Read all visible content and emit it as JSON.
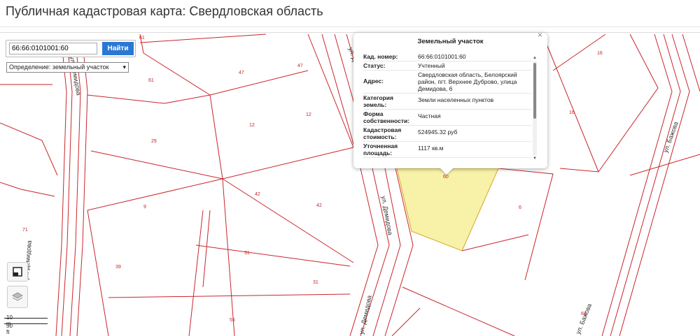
{
  "page": {
    "title": "Публичная кадастровая карта: Свердловская область"
  },
  "search": {
    "value": "66:66:0101001:60",
    "button_label": "Найти"
  },
  "definition_select": {
    "label": "Определение:",
    "selected": "земельный участок"
  },
  "scale": {
    "metric": "10 m",
    "imperial": "50 ft"
  },
  "parcel_labels": {
    "p61a": "61",
    "p61b": "61",
    "p47a": "47",
    "p47b": "47",
    "p12a": "12",
    "p12b": "12",
    "p29": "29",
    "p9": "9",
    "p42a": "42",
    "p42b": "42",
    "p31a": "31",
    "p31b": "31",
    "p39": "39",
    "p55": "55",
    "p71": "71",
    "p6": "6",
    "p16a": "16",
    "p16b": "16",
    "p68": "68",
    "p60": "60"
  },
  "streets": {
    "demidova_top": "ул. Демидова",
    "demidova_mid": "ул. Демидова",
    "demidova_bottom": "ул. Демидова",
    "bazhova_top": "ул. Бажова",
    "bazhova_bottom": "ул. Бажова",
    "left_street_top": "ул. Демидова",
    "left_street_bottom": "ул. Демидова"
  },
  "popup": {
    "title": "Земельный участок",
    "close": "×",
    "rows": [
      {
        "key": "Кад. номер:",
        "value": "66:66:0101001:60"
      },
      {
        "key": "Статус:",
        "value": "Учтенный"
      },
      {
        "key": "Адрес:",
        "value": "Свердловская область, Белоярский район, пгт. Верхнее Дуброво, улица Демидова, 6"
      },
      {
        "key": "Категория земель:",
        "value": "Земли населенных пунктов"
      },
      {
        "key": "Форма собственности:",
        "value": "Частная"
      },
      {
        "key": "Кадастровая стоимость:",
        "value": "524945.32 руб"
      },
      {
        "key": "Уточненная площадь:",
        "value": "1117 кв.м"
      }
    ]
  },
  "colors": {
    "boundary": "#c9262c",
    "selected_fill": "#f7f2a8",
    "selected_stroke": "#e0b040",
    "button": "#2a78d4"
  },
  "icons": {
    "basemap": "map-toggle-icon",
    "layers": "layers-icon"
  }
}
